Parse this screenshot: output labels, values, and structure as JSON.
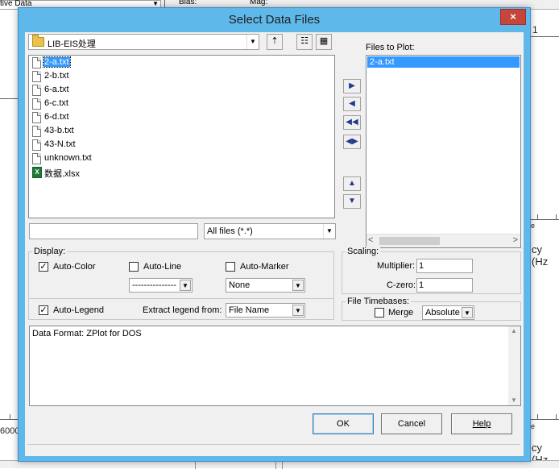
{
  "background": {
    "top_combo_text": "tive Data",
    "hdr1": "Bias:",
    "hdr2": "Mag:",
    "right_num": "1",
    "freq_label": "cy (Hz",
    "axis_num": "6000",
    "axis_small": "e"
  },
  "dialog": {
    "title": "Select Data Files",
    "close": "×"
  },
  "folder": {
    "name": "LIB-EIS处理",
    "dropdown": "▼",
    "up_icon": "⇡",
    "list_icon": "☷",
    "detail_icon": "▦"
  },
  "files": [
    {
      "name": "2-a.txt",
      "type": "txt",
      "selected": true
    },
    {
      "name": "2-b.txt",
      "type": "txt"
    },
    {
      "name": "6-a.txt",
      "type": "txt"
    },
    {
      "name": "6-c.txt",
      "type": "txt"
    },
    {
      "name": "6-d.txt",
      "type": "txt"
    },
    {
      "name": "43-b.txt",
      "type": "txt"
    },
    {
      "name": "43-N.txt",
      "type": "txt"
    },
    {
      "name": "unknown.txt",
      "type": "txt"
    },
    {
      "name": "数据.xlsx",
      "type": "xlsx"
    }
  ],
  "xls_icon_text": "X",
  "filename_input": "",
  "filter": {
    "value": "All files (*.*)",
    "dropdown": "▼"
  },
  "arrows": {
    "add": "▶",
    "remove": "◀",
    "remove_all": "◀◀",
    "swap": "◀▶",
    "up": "▲",
    "down": "▼"
  },
  "files_to_plot": {
    "label": "Files to Plot:",
    "items": [
      "2-a.txt"
    ],
    "scroll_left": "<",
    "scroll_right": ">"
  },
  "display": {
    "label": "Display:",
    "auto_color": {
      "label": "Auto-Color",
      "checked": "✓"
    },
    "auto_line": {
      "label": "Auto-Line",
      "checked": ""
    },
    "auto_marker": {
      "label": "Auto-Marker",
      "checked": ""
    },
    "line_style_value": "---------------",
    "marker_value": "None",
    "auto_legend": {
      "label": "Auto-Legend",
      "checked": "✓"
    },
    "extract_label": "Extract legend from:",
    "extract_value": "File Name",
    "dropdown": "▼"
  },
  "scaling": {
    "label": "Scaling:",
    "multiplier_label": "Multiplier:",
    "multiplier_value": "1",
    "czero_label": "C-zero:",
    "czero_value": "1"
  },
  "timebases": {
    "label": "File Timebases:",
    "merge_label": "Merge",
    "merge_checked": "",
    "mode_value": "Absolute",
    "dropdown": "▼"
  },
  "data_format": {
    "text": "Data Format: ZPlot for DOS",
    "up": "▲",
    "down": "▼"
  },
  "buttons": {
    "ok": "OK",
    "cancel": "Cancel",
    "help": "Help"
  }
}
